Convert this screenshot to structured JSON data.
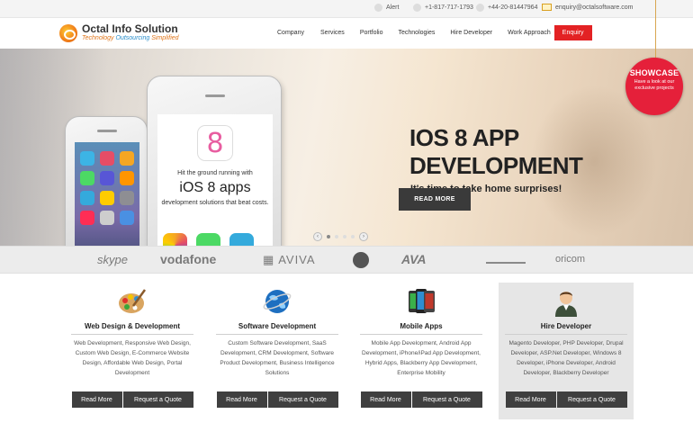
{
  "topbar": {
    "alert": "Alert",
    "phone_us": "+1-817-717-1793",
    "phone_uk": "+44-20-81447964",
    "email": "enquiry@octalsoftware.com"
  },
  "brand": {
    "name": "Octal Info Solution",
    "tagline_part1": "Technology ",
    "tagline_part2": "Outsourcing",
    "tagline_part3": " Simplified"
  },
  "nav": {
    "items": [
      "Company",
      "Services",
      "Portfolio",
      "Technologies",
      "Hire Developer",
      "Work Approach"
    ],
    "enquiry": "Enquiry"
  },
  "hero": {
    "title_line1": "IOS 8 APP",
    "title_line2": "DEVELOPMENT",
    "subtitle": "It's time to take home surprises!",
    "button": "READ MORE",
    "phone_icon_text": "8",
    "phone_line1": "Hit the ground running with",
    "phone_line2": "iOS 8 apps",
    "phone_line3": "development solutions that beat costs."
  },
  "showcase": {
    "title": "SHOWCASE",
    "text": "Have a look at our exclusive projects"
  },
  "slider": {
    "dots": 5,
    "active_index": 0
  },
  "clients": [
    "skype",
    "vodafone",
    "AVIVA",
    "AVA",
    "oricom"
  ],
  "services": [
    {
      "title": "Web Design & Development",
      "desc": "Web Development, Responsive Web Design, Custom Web Design, E-Commerce Website Design, Affordable Web Design, Portal Development",
      "more": "Read More",
      "quote": "Request a Quote",
      "icon": "palette-icon"
    },
    {
      "title": "Software Development",
      "desc": "Custom Software Development, SaaS Development, CRM Development, Software Product Development, Business Intelligence Solutions",
      "more": "Read More",
      "quote": "Request a Quote",
      "icon": "globe-icon"
    },
    {
      "title": "Mobile Apps",
      "desc": "Mobile App Development, Android App Development, iPhone/iPad App Development, Hybrid Apps, Blackberry App Development, Enterprise Mobility",
      "more": "Read More",
      "quote": "Request a Quote",
      "icon": "smartphones-icon"
    },
    {
      "title": "Hire Developer",
      "desc": "Magento Developer, PHP Developer, Drupal Developer, ASP.Net Developer, Windows 8 Developer, iPhone Developer, Android Developer, Blackberry Developer",
      "more": "Read More",
      "quote": "Request a Quote",
      "icon": "developer-avatar-icon"
    }
  ],
  "colors": {
    "accent_red": "#e32224",
    "showcase_red": "#e5203a",
    "button_dark": "#3f3f3f",
    "brand_orange": "#e0761b"
  }
}
